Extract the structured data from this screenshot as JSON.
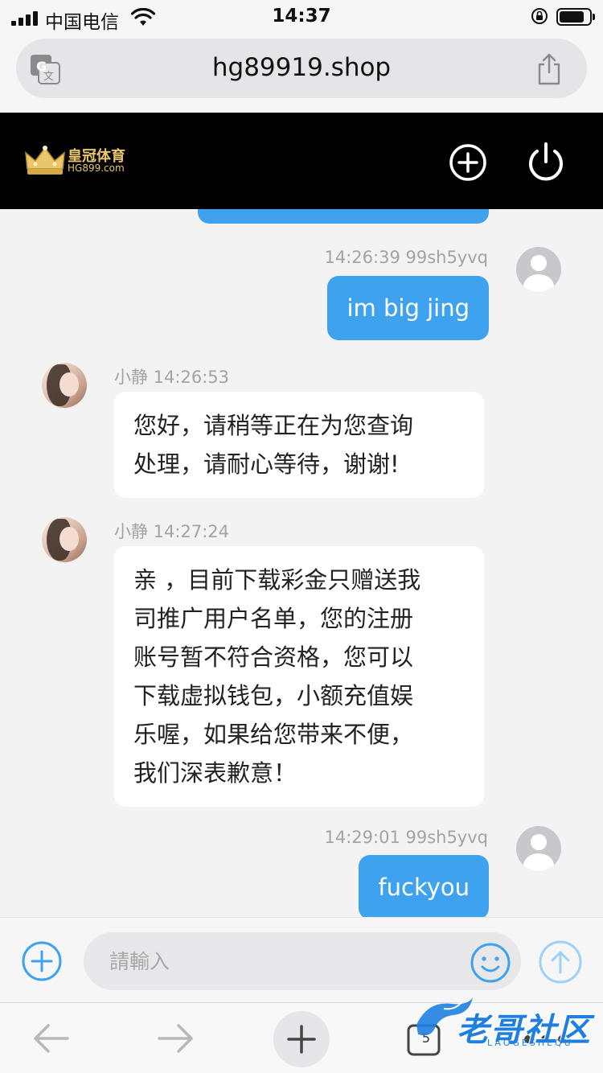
{
  "status_bar": {
    "carrier": "中国电信",
    "time": "14:37"
  },
  "browser": {
    "url": "hg89919.shop"
  },
  "app_header": {
    "logo_title": "皇冠体育",
    "logo_subtitle": "HG899.com"
  },
  "messages": [
    {
      "side": "out",
      "meta": "14:26:39 99sh5yvq",
      "text": "im big jing"
    },
    {
      "side": "in",
      "meta": "小静 14:26:53",
      "lines": [
        "您好，请稍等正在为您查询",
        "处理，请耐心等待，谢谢!"
      ]
    },
    {
      "side": "in",
      "meta": "小静 14:27:24",
      "lines": [
        "亲 ，目前下载彩金只赠送我",
        "司推广用户名单，您的注册",
        "账号暂不符合资格，您可以",
        "下载虚拟钱包，小额充值娱",
        "乐喔，如果给您带来不便，",
        "我们深表歉意！"
      ]
    },
    {
      "side": "out",
      "meta": "14:29:01 99sh5yvq",
      "text": "fuckyou"
    }
  ],
  "input_bar": {
    "placeholder": "請輸入"
  },
  "toolbar": {
    "tab_count": "5"
  },
  "watermark": {
    "text": "老哥社区",
    "subtext": "LAOGESHEQU"
  },
  "colors": {
    "accent": "#3fa2ef",
    "header_bg": "#000000",
    "logo_gold": "#e9c66b"
  }
}
